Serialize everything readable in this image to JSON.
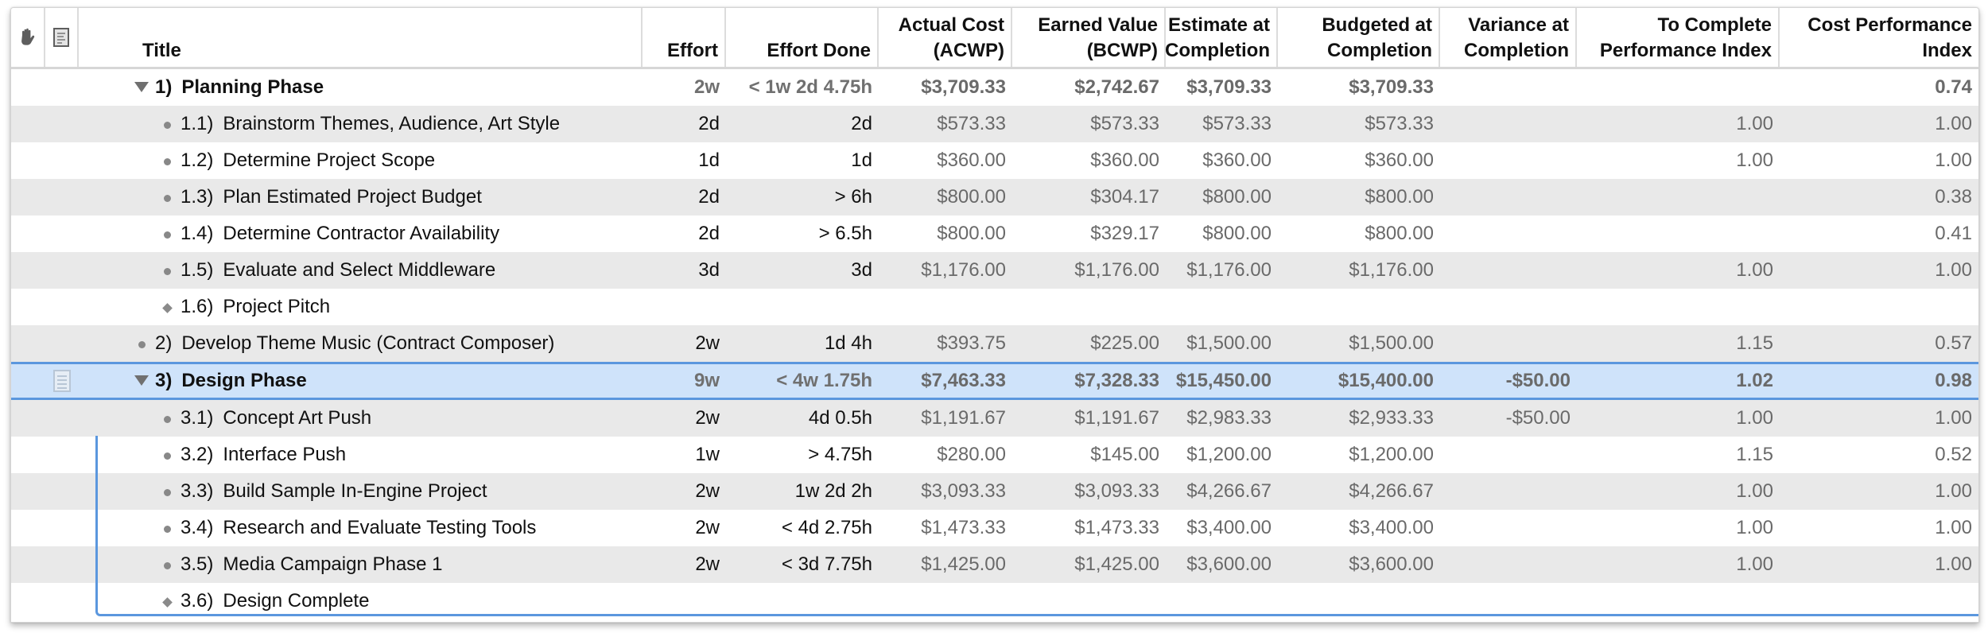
{
  "header": {
    "columns": [
      {
        "id": "handle",
        "icon": "hand-icon"
      },
      {
        "id": "notes",
        "icon": "note-icon"
      },
      {
        "id": "title",
        "label": "Title"
      },
      {
        "id": "effort",
        "label": "Effort"
      },
      {
        "id": "effort_done",
        "label": "Effort Done"
      },
      {
        "id": "acwp",
        "label": "Actual Cost\n(ACWP)",
        "line1": "Actual Cost",
        "line2": "(ACWP)"
      },
      {
        "id": "bcwp",
        "label": "Earned Value\n(BCWP)",
        "line1": "Earned Value",
        "line2": "(BCWP)"
      },
      {
        "id": "eac",
        "label": "Estimate at\nCompletion",
        "line1": "Estimate at",
        "line2": "Completion"
      },
      {
        "id": "bac",
        "label": "Budgeted at\nCompletion",
        "line1": "Budgeted at",
        "line2": "Completion"
      },
      {
        "id": "vac",
        "label": "Variance at\nCompletion",
        "line1": "Variance at",
        "line2": "Completion"
      },
      {
        "id": "tcpi",
        "label": "To Complete\nPerformance Index",
        "line1": "To Complete",
        "line2": "Performance Index"
      },
      {
        "id": "cpi",
        "label": "Cost Performance\nIndex",
        "line1": "Cost Performance",
        "line2": "Index"
      }
    ]
  },
  "rows": [
    {
      "num": "1)",
      "title": "Planning Phase",
      "type": "group",
      "expanded": true,
      "level": 0,
      "effort": "2w",
      "effort_done": "< 1w 2d 4.75h",
      "acwp": "$3,709.33",
      "bcwp": "$2,742.67",
      "eac": "$3,709.33",
      "bac": "$3,709.33",
      "vac": "",
      "tcpi": "",
      "cpi": "0.74"
    },
    {
      "num": "1.1)",
      "title": "Brainstorm Themes, Audience, Art Style",
      "type": "task",
      "level": 1,
      "effort": "2d",
      "effort_done": "2d",
      "acwp": "$573.33",
      "bcwp": "$573.33",
      "eac": "$573.33",
      "bac": "$573.33",
      "vac": "",
      "tcpi": "1.00",
      "cpi": "1.00"
    },
    {
      "num": "1.2)",
      "title": "Determine Project Scope",
      "type": "task",
      "level": 1,
      "effort": "1d",
      "effort_done": "1d",
      "acwp": "$360.00",
      "bcwp": "$360.00",
      "eac": "$360.00",
      "bac": "$360.00",
      "vac": "",
      "tcpi": "1.00",
      "cpi": "1.00"
    },
    {
      "num": "1.3)",
      "title": "Plan Estimated Project Budget",
      "type": "task",
      "level": 1,
      "effort": "2d",
      "effort_done": "> 6h",
      "acwp": "$800.00",
      "bcwp": "$304.17",
      "eac": "$800.00",
      "bac": "$800.00",
      "vac": "",
      "tcpi": "",
      "cpi": "0.38"
    },
    {
      "num": "1.4)",
      "title": "Determine Contractor Availability",
      "type": "task",
      "level": 1,
      "effort": "2d",
      "effort_done": "> 6.5h",
      "acwp": "$800.00",
      "bcwp": "$329.17",
      "eac": "$800.00",
      "bac": "$800.00",
      "vac": "",
      "tcpi": "",
      "cpi": "0.41"
    },
    {
      "num": "1.5)",
      "title": "Evaluate and Select Middleware",
      "type": "task",
      "level": 1,
      "effort": "3d",
      "effort_done": "3d",
      "acwp": "$1,176.00",
      "bcwp": "$1,176.00",
      "eac": "$1,176.00",
      "bac": "$1,176.00",
      "vac": "",
      "tcpi": "1.00",
      "cpi": "1.00"
    },
    {
      "num": "1.6)",
      "title": "Project Pitch",
      "type": "milestone",
      "level": 1,
      "effort": "",
      "effort_done": "",
      "acwp": "",
      "bcwp": "",
      "eac": "",
      "bac": "",
      "vac": "",
      "tcpi": "",
      "cpi": ""
    },
    {
      "num": "2)",
      "title": "Develop Theme Music (Contract Composer)",
      "type": "task",
      "level": 0,
      "effort": "2w",
      "effort_done": "1d 4h",
      "acwp": "$393.75",
      "bcwp": "$225.00",
      "eac": "$1,500.00",
      "bac": "$1,500.00",
      "vac": "",
      "tcpi": "1.15",
      "cpi": "0.57"
    },
    {
      "num": "3)",
      "title": "Design Phase",
      "type": "group",
      "expanded": true,
      "selected": true,
      "has_note": true,
      "level": 0,
      "effort": "9w",
      "effort_done": "< 4w 1.75h",
      "acwp": "$7,463.33",
      "bcwp": "$7,328.33",
      "eac": "$15,450.00",
      "bac": "$15,400.00",
      "vac": "-$50.00",
      "tcpi": "1.02",
      "cpi": "0.98"
    },
    {
      "num": "3.1)",
      "title": "Concept Art Push",
      "type": "task",
      "level": 1,
      "effort": "2w",
      "effort_done": "4d 0.5h",
      "acwp": "$1,191.67",
      "bcwp": "$1,191.67",
      "eac": "$2,983.33",
      "bac": "$2,933.33",
      "vac": "-$50.00",
      "tcpi": "1.00",
      "cpi": "1.00"
    },
    {
      "num": "3.2)",
      "title": "Interface Push",
      "type": "task",
      "level": 1,
      "effort": "1w",
      "effort_done": "> 4.75h",
      "acwp": "$280.00",
      "bcwp": "$145.00",
      "eac": "$1,200.00",
      "bac": "$1,200.00",
      "vac": "",
      "tcpi": "1.15",
      "cpi": "0.52"
    },
    {
      "num": "3.3)",
      "title": "Build Sample In-Engine Project",
      "type": "task",
      "level": 1,
      "effort": "2w",
      "effort_done": "1w 2d 2h",
      "acwp": "$3,093.33",
      "bcwp": "$3,093.33",
      "eac": "$4,266.67",
      "bac": "$4,266.67",
      "vac": "",
      "tcpi": "1.00",
      "cpi": "1.00"
    },
    {
      "num": "3.4)",
      "title": "Research and Evaluate Testing Tools",
      "type": "task",
      "level": 1,
      "effort": "2w",
      "effort_done": "< 4d 2.75h",
      "acwp": "$1,473.33",
      "bcwp": "$1,473.33",
      "eac": "$3,400.00",
      "bac": "$3,400.00",
      "vac": "",
      "tcpi": "1.00",
      "cpi": "1.00"
    },
    {
      "num": "3.5)",
      "title": "Media Campaign Phase 1",
      "type": "task",
      "level": 1,
      "effort": "2w",
      "effort_done": "< 3d 7.75h",
      "acwp": "$1,425.00",
      "bcwp": "$1,425.00",
      "eac": "$3,600.00",
      "bac": "$3,600.00",
      "vac": "",
      "tcpi": "1.00",
      "cpi": "1.00"
    },
    {
      "num": "3.6)",
      "title": "Design Complete",
      "type": "milestone",
      "level": 1,
      "effort": "",
      "effort_done": "",
      "acwp": "",
      "bcwp": "",
      "eac": "",
      "bac": "",
      "vac": "",
      "tcpi": "",
      "cpi": ""
    }
  ],
  "colors": {
    "selection": "#cfe3fa",
    "selection_border": "#5b97de",
    "alt_row": "#e9e9e9"
  }
}
